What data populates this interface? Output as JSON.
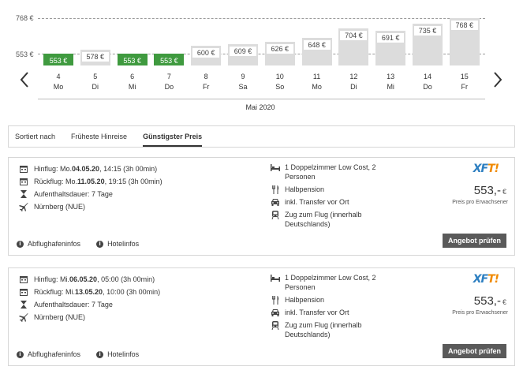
{
  "chart": {
    "y_labels": [
      "768 €",
      "553 €"
    ],
    "y_values": [
      768,
      553
    ],
    "month": "Mai 2020",
    "prev_icon": "chevron-left-icon",
    "next_icon": "chevron-right-icon",
    "colors": {
      "cheapest": "#3f9a3f",
      "default": "#dcdcdc"
    }
  },
  "chart_data": {
    "type": "bar",
    "categories": [
      "4 Mo",
      "5 Di",
      "6 Mi",
      "7 Do",
      "8 Fr",
      "9 Sa",
      "10 So",
      "11 Mo",
      "12 Di",
      "13 Mi",
      "14 Do",
      "15 Fr"
    ],
    "days": [
      {
        "num": "4",
        "wd": "Mo",
        "value": 553,
        "label": "553 €",
        "cheapest": true
      },
      {
        "num": "5",
        "wd": "Di",
        "value": 578,
        "label": "578 €",
        "cheapest": false
      },
      {
        "num": "6",
        "wd": "Mi",
        "value": 553,
        "label": "553 €",
        "cheapest": true
      },
      {
        "num": "7",
        "wd": "Do",
        "value": 553,
        "label": "553 €",
        "cheapest": true
      },
      {
        "num": "8",
        "wd": "Fr",
        "value": 600,
        "label": "600 €",
        "cheapest": false
      },
      {
        "num": "9",
        "wd": "Sa",
        "value": 609,
        "label": "609 €",
        "cheapest": false
      },
      {
        "num": "10",
        "wd": "So",
        "value": 626,
        "label": "626 €",
        "cheapest": false
      },
      {
        "num": "11",
        "wd": "Mo",
        "value": 648,
        "label": "648 €",
        "cheapest": false
      },
      {
        "num": "12",
        "wd": "Di",
        "value": 704,
        "label": "704 €",
        "cheapest": false
      },
      {
        "num": "13",
        "wd": "Mi",
        "value": 691,
        "label": "691 €",
        "cheapest": false
      },
      {
        "num": "14",
        "wd": "Do",
        "value": 735,
        "label": "735 €",
        "cheapest": false
      },
      {
        "num": "15",
        "wd": "Fr",
        "value": 768,
        "label": "768 €",
        "cheapest": false
      }
    ],
    "ylim": [
      553,
      768
    ],
    "xlabel": "Mai 2020"
  },
  "sort": {
    "label": "Sortiert nach",
    "options": [
      "Früheste Hinreise",
      "Günstigster Preis"
    ],
    "active": "Günstigster Preis"
  },
  "offers": [
    {
      "hinflug_prefix": "Hinflug: Mo. ",
      "hinflug_date": "04.05.20",
      "hinflug_rest": ", 14:15 (3h 00min)",
      "rueckflug_prefix": "Rückflug: Mo. ",
      "rueckflug_date": "11.05.20",
      "rueckflug_rest": ", 19:15 (3h 00min)",
      "duration": "Aufenthaltsdauer: 7 Tage",
      "airport": "Nürnberg (NUE)",
      "room": "1 Doppelzimmer Low Cost, 2 Personen",
      "board": "Halbpension",
      "transfer": "inkl. Transfer vor Ort",
      "train": "Zug zum Flug (innerhalb Deutschlands)",
      "logo_a": "XF",
      "logo_b": "T!",
      "price": "553,-",
      "currency": "€",
      "price_note": "Preis pro Erwachsener",
      "airport_info": "Abflughafeninfos",
      "hotel_info": "Hotelinfos",
      "cta": "Angebot prüfen"
    },
    {
      "hinflug_prefix": "Hinflug: Mi. ",
      "hinflug_date": "06.05.20",
      "hinflug_rest": ", 05:00 (3h 00min)",
      "rueckflug_prefix": "Rückflug: Mi. ",
      "rueckflug_date": "13.05.20",
      "rueckflug_rest": ", 10:00 (3h 00min)",
      "duration": "Aufenthaltsdauer: 7 Tage",
      "airport": "Nürnberg (NUE)",
      "room": "1 Doppelzimmer Low Cost, 2 Personen",
      "board": "Halbpension",
      "transfer": "inkl. Transfer vor Ort",
      "train": "Zug zum Flug (innerhalb Deutschlands)",
      "logo_a": "XF",
      "logo_b": "T!",
      "price": "553,-",
      "currency": "€",
      "price_note": "Preis pro Erwachsener",
      "airport_info": "Abflughafeninfos",
      "hotel_info": "Hotelinfos",
      "cta": "Angebot prüfen"
    }
  ],
  "logo_colors": {
    "x": "#2d7fc1",
    "f": "#2d7fc1",
    "t": "#f08a00"
  }
}
